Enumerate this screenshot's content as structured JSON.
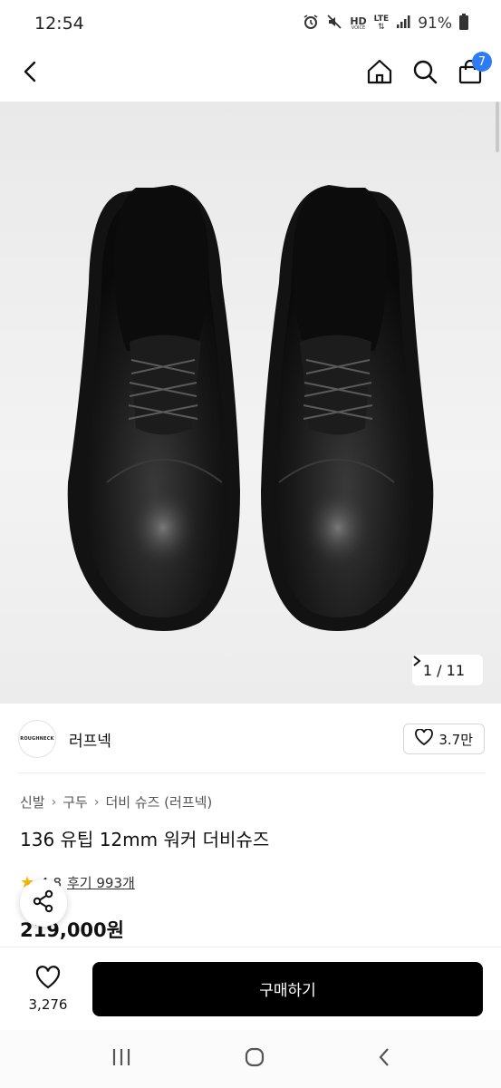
{
  "status_bar": {
    "time": "12:54",
    "hd": "HD",
    "voice": "VOICE",
    "lte": "LTE",
    "battery": "91%"
  },
  "nav": {
    "cart_count": "7"
  },
  "gallery": {
    "pager_text": "1 / 11"
  },
  "brand": {
    "logo_text": "ROUGHNECK",
    "name": "러프넥",
    "like_count": "3.7만"
  },
  "breadcrumb": [
    "신발",
    "구두",
    "더비 슈즈 (러프넥)"
  ],
  "product": {
    "title": "136 유팁 12mm 워커 더비슈즈",
    "rating": "4.8",
    "review_label": "후기 993개",
    "price": "219,000원"
  },
  "bottom_bar": {
    "wish_count": "3,276",
    "buy_label": "구매하기"
  },
  "colors": {
    "accent_badge": "#2e7bf6",
    "buy_button": "#000000",
    "star": "#f5b800"
  },
  "icons": [
    "back-icon",
    "home-icon",
    "search-icon",
    "cart-icon",
    "heart-icon",
    "share-icon",
    "chevron-right-icon",
    "recent-apps-icon",
    "home-circle-icon",
    "system-back-icon"
  ]
}
